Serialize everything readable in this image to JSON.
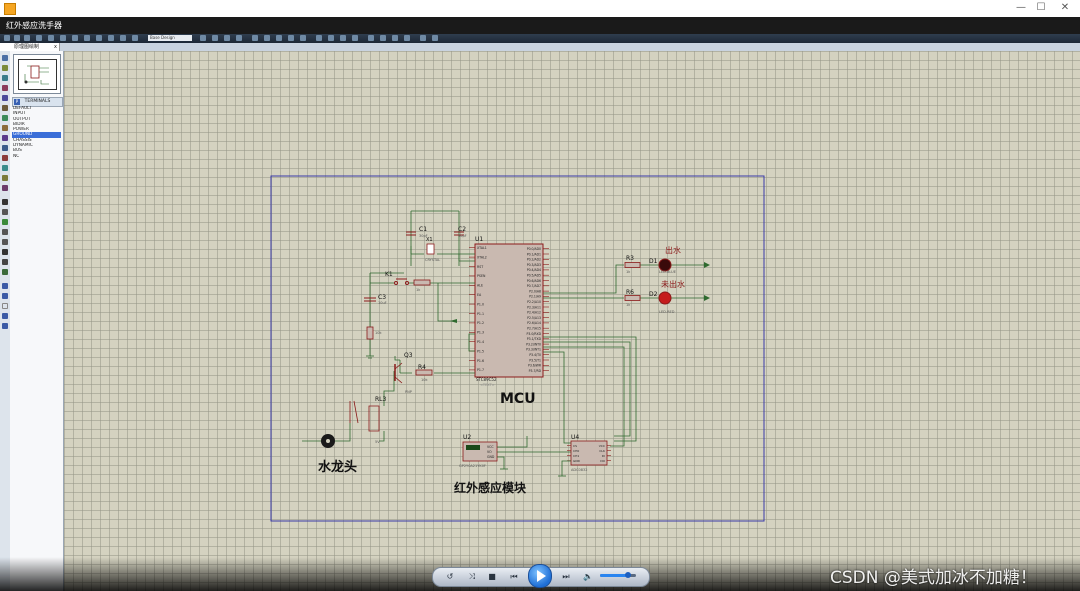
{
  "app": {
    "outer_title": "",
    "inner_title": "红外感应洗手器",
    "tab_label": "原理图绘制",
    "tab_close": "x",
    "toolbar_combo": "Base Design"
  },
  "window_controls": {
    "minimize": "—",
    "maximize": "☐",
    "close": "✕"
  },
  "left_panel": {
    "terminals_header": "TERMINALS",
    "terminals_p": "P",
    "terminals": [
      "DEFAULT",
      "INPUT",
      "OUTPUT",
      "BIDIR",
      "POWER",
      "GROUND",
      "CHASSIS",
      "DYNAMIC",
      "BUS",
      "NC"
    ],
    "selected_index": 5
  },
  "schematic": {
    "u1_ref": "U1",
    "u1_part": "STC89C52",
    "u1_text": "<TEXT>",
    "u1_left_pins": [
      "XTAL1",
      "XTAL2",
      "RST",
      "PSEN",
      "ALE",
      "EA",
      "P1.0",
      "P1.1",
      "P1.2",
      "P1.3",
      "P1.4",
      "P1.5",
      "P1.6",
      "P1.7"
    ],
    "u1_right_pins": [
      "P0.0/AD0",
      "P0.1/AD1",
      "P0.2/AD2",
      "P0.3/AD3",
      "P0.4/AD4",
      "P0.5/AD5",
      "P0.6/AD6",
      "P0.7/AD7",
      "P2.0/A8",
      "P2.1/A9",
      "P2.2/A10",
      "P2.3/A11",
      "P2.4/A12",
      "P2.5/A13",
      "P2.6/A14",
      "P2.7/A15",
      "P3.0/RXD",
      "P3.1/TXD",
      "P3.2/INT0",
      "P3.3/INT1",
      "P3.4/T0",
      "P3.5/T1",
      "P3.6/WR",
      "P3.7/RD"
    ],
    "c1": "C1",
    "c1_val": "30pF",
    "c2": "C2",
    "c2_val": "30pF",
    "x1": "X1",
    "x1_part": "CRYSTAL",
    "k1": "K1",
    "c3": "C3",
    "c3_val": "10uF",
    "r4": "R4",
    "r4_val": "10k",
    "r_rst_val": "10k",
    "r_base_val": "1k",
    "q3": "Q3",
    "q3_part": "PNP",
    "rl3": "RL3",
    "rl3_val": "5V",
    "r3": "R3",
    "r6": "R6",
    "r3_val": "1k",
    "r6_val": "1k",
    "d1": "D1",
    "d1_part": "LED-BLUE",
    "d2": "D2",
    "d2_part": "LED-RED",
    "d1_label": "出水",
    "d2_label": "未出水",
    "mcu_label": "MCU",
    "faucet_label": "水龙头",
    "ir_label": "红外感应模块",
    "u2": "U2",
    "u2_part": "GP2Y0A21YK0F",
    "u2_pins": [
      "VCC",
      "VO",
      "GND"
    ],
    "u4": "U4",
    "u4_part": "ADC0832",
    "u4_left_pins": [
      "CS",
      "CH0",
      "CH1",
      "GND"
    ],
    "u4_right_pins": [
      "VCC",
      "CLK",
      "DI",
      "DO"
    ]
  },
  "player": {
    "btn_repeat": "↺",
    "btn_shuffle": "⤨",
    "btn_stop": "■",
    "btn_prev": "⏮",
    "btn_next": "⏭",
    "btn_volume": "🔈",
    "volume_level": 0.78
  },
  "watermark": "CSDN @美式加冰不加糖！",
  "colors": {
    "wire": "#2f6a2f",
    "component": "#8b1a1a",
    "border": "#3a3aa8",
    "grid": "#d4d2c0"
  }
}
